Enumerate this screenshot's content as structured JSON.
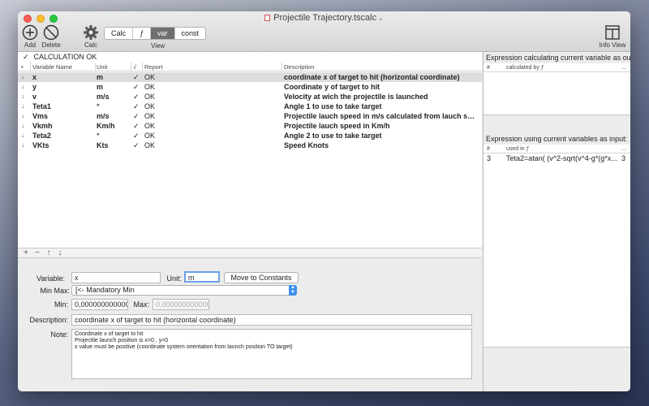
{
  "window": {
    "title": "Projectile Trajectory.tscalc"
  },
  "toolbar": {
    "add_label": "Add",
    "delete_label": "Delete",
    "calc_label": "Calc",
    "view_label": "View",
    "info_view_label": "Info View",
    "segments": [
      "Calc",
      "ƒ",
      "var",
      "const"
    ],
    "selected_segment": "var"
  },
  "status": {
    "check": "✓",
    "text": "CALCULATION OK"
  },
  "table": {
    "headers": {
      "name": "Variable Name",
      "unit": "Unit",
      "check": "√",
      "report": "Report",
      "description": "Description"
    },
    "rows": [
      {
        "name": "x",
        "unit": "m",
        "check": "✓",
        "report": "OK",
        "description": "coordinate x of target to hit (horizontal coordinate)"
      },
      {
        "name": "y",
        "unit": "m",
        "check": "✓",
        "report": "OK",
        "description": "Coordinate y of target to hit"
      },
      {
        "name": "v",
        "unit": "m/s",
        "check": "✓",
        "report": "OK",
        "description": "Velocity at wich the projectile is launched"
      },
      {
        "name": "Teta1",
        "unit": "°",
        "check": "✓",
        "report": "OK",
        "description": "Angle 1 to use to take target"
      },
      {
        "name": "Vms",
        "unit": "m/s",
        "check": "✓",
        "report": "OK",
        "description": "Projectile lauch speed in m/s calculated from lauch speed in Km/h"
      },
      {
        "name": "Vkmh",
        "unit": "Km/h",
        "check": "✓",
        "report": "OK",
        "description": "Projectile lauch speed in Km/h"
      },
      {
        "name": "Teta2",
        "unit": "°",
        "check": "✓",
        "report": "OK",
        "description": "Angle 2 to use to take target"
      },
      {
        "name": "VKts",
        "unit": "Kts",
        "check": "✓",
        "report": "OK",
        "description": "Speed Knots"
      }
    ]
  },
  "bottom_bar": [
    "+",
    "−",
    "↑",
    "↓"
  ],
  "form": {
    "variable_label": "Variable:",
    "variable_value": "x",
    "unit_label": "Unit:",
    "unit_value": "m",
    "move_button": "Move to Constants",
    "minmax_label": "Min Max:",
    "minmax_value": "[<- Mandatory Min",
    "min_label": "Min:",
    "min_value": "0,000000000000",
    "max_label": "Max:",
    "max_value": "0,000000000000",
    "description_label": "Description:",
    "description_value": "coordinate x of target to hit (horizontal coordinate)",
    "note_label": "Note:",
    "note_lines": [
      "Coordinate x of target to hit",
      "Projectile launch position is x=0 , y=0",
      "x value must be positive (coordinate system orientation from launch position TO target)"
    ]
  },
  "right_panel": {
    "top_title": "Expression calculating current variable as outpu",
    "top_headers": {
      "num": "#",
      "col": "calculated by ƒ",
      "more": "..."
    },
    "bottom_title": "Expression using current variables as input:",
    "bottom_headers": {
      "num": "#",
      "col": "used in ƒ",
      "more": "..."
    },
    "bottom_rows": [
      {
        "num": "3",
        "expr": "Teta2=atan(  (v^2-sqrt(v^4-g*(g*x...",
        "count": "3"
      }
    ]
  }
}
